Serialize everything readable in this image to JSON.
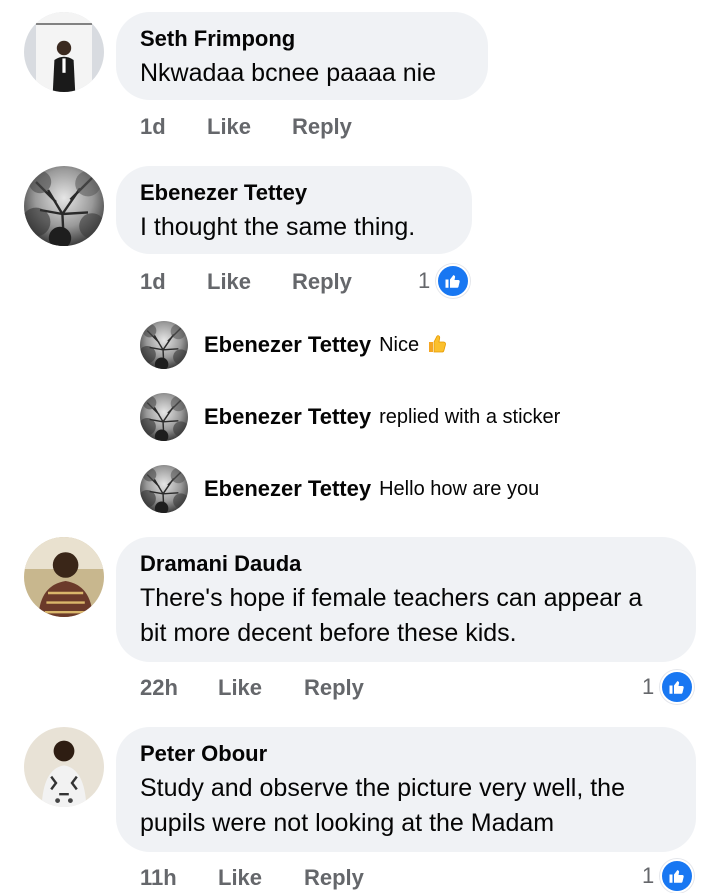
{
  "comments": [
    {
      "author": "Seth Frimpong",
      "text": "Nkwadaa bcnee paaaa nie",
      "time": "1d",
      "like": "Like",
      "reply": "Reply",
      "reactions": ""
    },
    {
      "author": "Ebenezer Tettey",
      "text": "I thought the same thing.",
      "time": "1d",
      "like": "Like",
      "reply": "Reply",
      "reactions": "1"
    },
    {
      "author": "Dramani Dauda",
      "text": "There's hope if female teachers can appear a bit more decent before these kids.",
      "time": "22h",
      "like": "Like",
      "reply": "Reply",
      "reactions": "1"
    },
    {
      "author": "Peter Obour",
      "text": "Study and observe the picture very well,  the pupils were not looking at the Madam",
      "time": "11h",
      "like": "Like",
      "reply": "Reply",
      "reactions": "1"
    }
  ],
  "replies": [
    {
      "author": "Ebenezer Tettey",
      "text": "Nice",
      "emoji": "thumbs-up-emoji"
    },
    {
      "author": "Ebenezer Tettey",
      "text": "replied with a sticker"
    },
    {
      "author": "Ebenezer Tettey",
      "text": "Hello how are you"
    }
  ],
  "colors": {
    "bubble": "#f0f2f5",
    "meta": "#65676b",
    "like_blue": "#1877f2"
  }
}
